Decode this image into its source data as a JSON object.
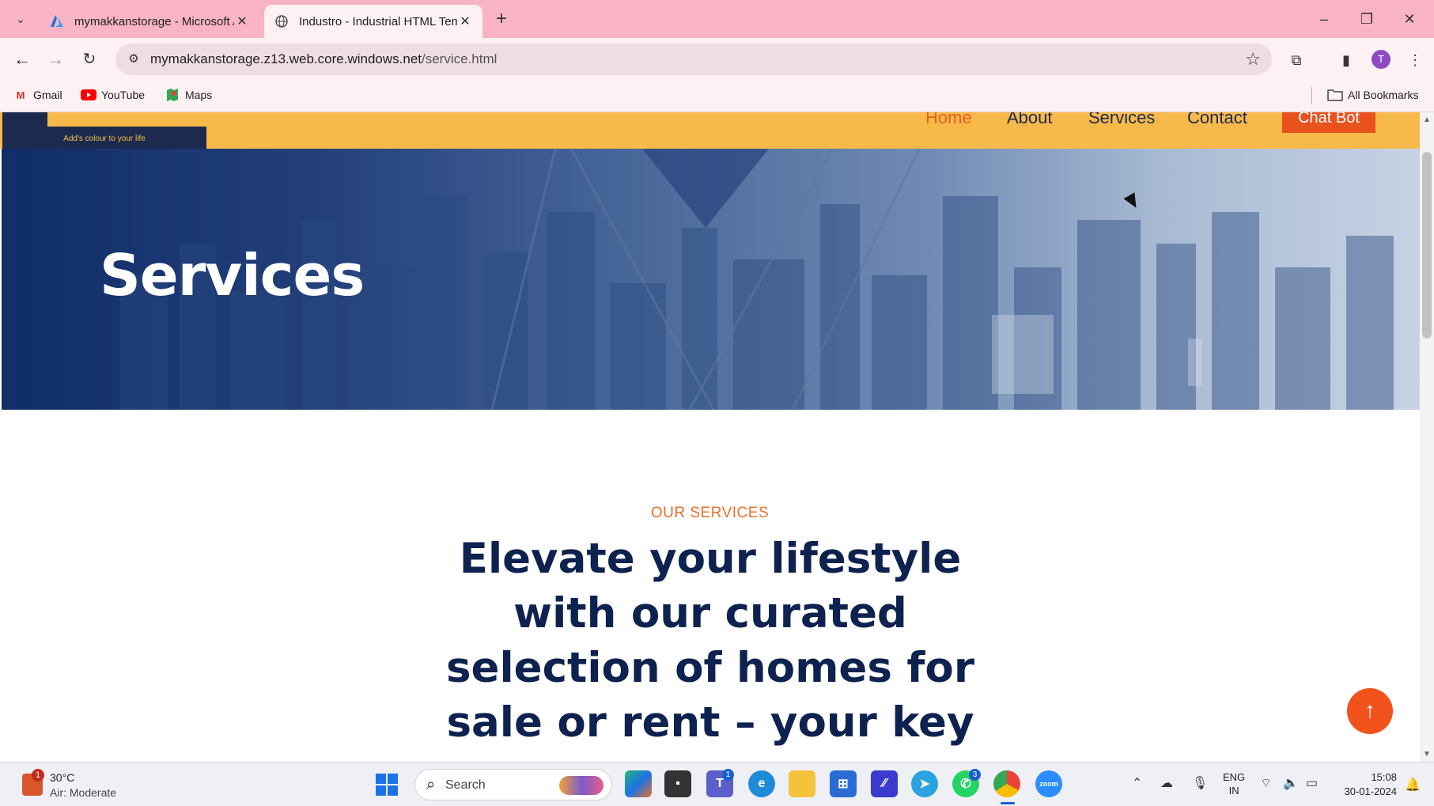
{
  "browser": {
    "tabs": [
      {
        "title": "mymakkanstorage - Microsoft A",
        "favicon": "azure-icon",
        "active": false
      },
      {
        "title": "Industro - Industrial HTML Tem",
        "favicon": "globe-icon",
        "active": true
      }
    ],
    "url_host": "mymakkanstorage.z13.web.core.windows.net",
    "url_path": "/service.html",
    "profile_initial": "T",
    "bookmarks": [
      {
        "label": "Gmail",
        "icon": "gmail-icon"
      },
      {
        "label": "YouTube",
        "icon": "youtube-icon"
      },
      {
        "label": "Maps",
        "icon": "maps-icon"
      }
    ],
    "all_bookmarks_label": "All Bookmarks"
  },
  "site": {
    "logo_tagline": "Add's colour to your life",
    "nav": [
      {
        "label": "Home",
        "active": true
      },
      {
        "label": "About",
        "active": false
      },
      {
        "label": "Services",
        "active": false
      },
      {
        "label": "Contact",
        "active": false
      }
    ],
    "chat_button": "Chat Bot",
    "hero_title": "Services",
    "eyebrow": "OUR SERVICES",
    "headline": "Elevate your lifestyle with our curated selection of homes for sale or rent – your key to",
    "back_to_top_icon": "arrow-up-icon"
  },
  "colors": {
    "nav_bg": "#f6b94a",
    "accent": "#e8521c",
    "headline": "#0e2250",
    "tab_bar": "#f8b4c4"
  },
  "taskbar": {
    "weather_temp": "30°C",
    "weather_desc": "Air: Moderate",
    "weather_badge": "1",
    "search_label": "Search",
    "teams_badge": "1",
    "whatsapp_badge": "3",
    "lang_line1": "ENG",
    "lang_line2": "IN",
    "time": "15:08",
    "date": "30-01-2024"
  }
}
